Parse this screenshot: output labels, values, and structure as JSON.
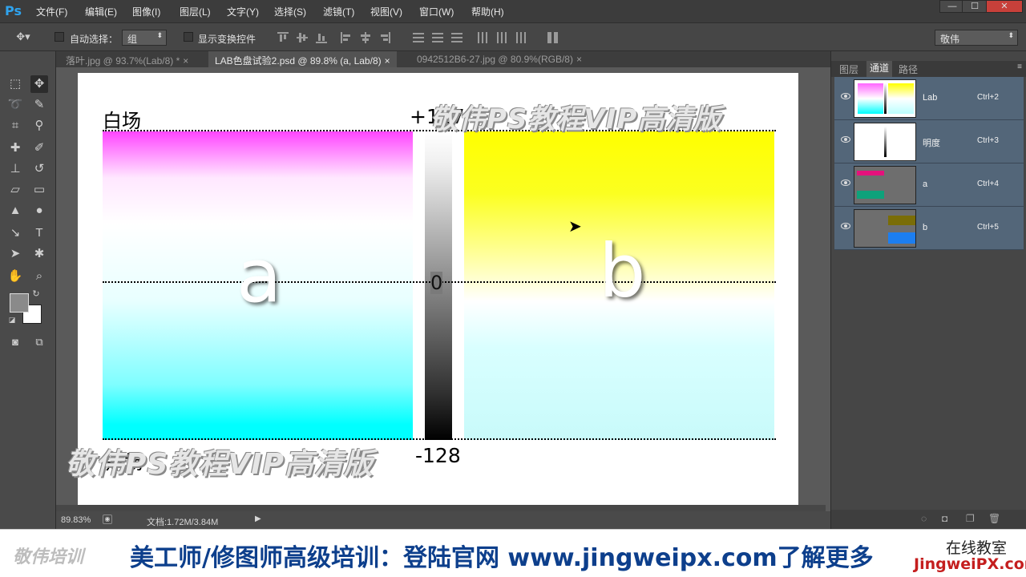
{
  "app": {
    "logo": "Ps"
  },
  "menu": [
    "文件(F)",
    "编辑(E)",
    "图像(I)",
    "图层(L)",
    "文字(Y)",
    "选择(S)",
    "滤镜(T)",
    "视图(V)",
    "窗口(W)",
    "帮助(H)"
  ],
  "window_controls": {
    "minimize": "—",
    "maximize": "☐",
    "close": "✕"
  },
  "options": {
    "auto_select_label": "自动选择：",
    "auto_select_value": "组",
    "show_transform_label": "显示变换控件",
    "workspace": "敬伟"
  },
  "tabs": [
    {
      "label": "落叶.jpg @ 93.7%(Lab/8) *",
      "close": "×",
      "active": false
    },
    {
      "label": "LAB色盘试验2.psd @ 89.8% (a, Lab/8)",
      "close": "×",
      "active": true
    },
    {
      "label": "0942512B6-27.jpg @ 80.9%(RGB/8)",
      "close": "×",
      "active": false
    }
  ],
  "canvas": {
    "label_white": "白场",
    "label_black": "黑场",
    "top_value": "+127",
    "zero_value": "0",
    "bottom_value": "-128",
    "letter_a": "a",
    "letter_b": "b",
    "watermark": "敬伟PS教程VIP高清版"
  },
  "status": {
    "zoom": "89.83%",
    "doc_info": "文档:1.72M/3.84M"
  },
  "panel": {
    "tabs": [
      "图层",
      "通道",
      "路径"
    ],
    "active_tab": "通道",
    "channels": [
      {
        "name": "Lab",
        "shortcut": "Ctrl+2"
      },
      {
        "name": "明度",
        "shortcut": "Ctrl+3"
      },
      {
        "name": "a",
        "shortcut": "Ctrl+4"
      },
      {
        "name": "b",
        "shortcut": "Ctrl+5"
      }
    ]
  },
  "banner": {
    "logo": "敬伟培训",
    "text": "美工师/修图师高级培训：登陆官网 www.jingweipx.com了解更多",
    "right_line1": "在线教室",
    "right_line2": "JingweiPX.com"
  },
  "colors": {
    "accent_blue": "#2fa3ee",
    "channel_row": "#536679",
    "banner_text": "#0d3f8c",
    "banner_link": "#c41e1e"
  }
}
